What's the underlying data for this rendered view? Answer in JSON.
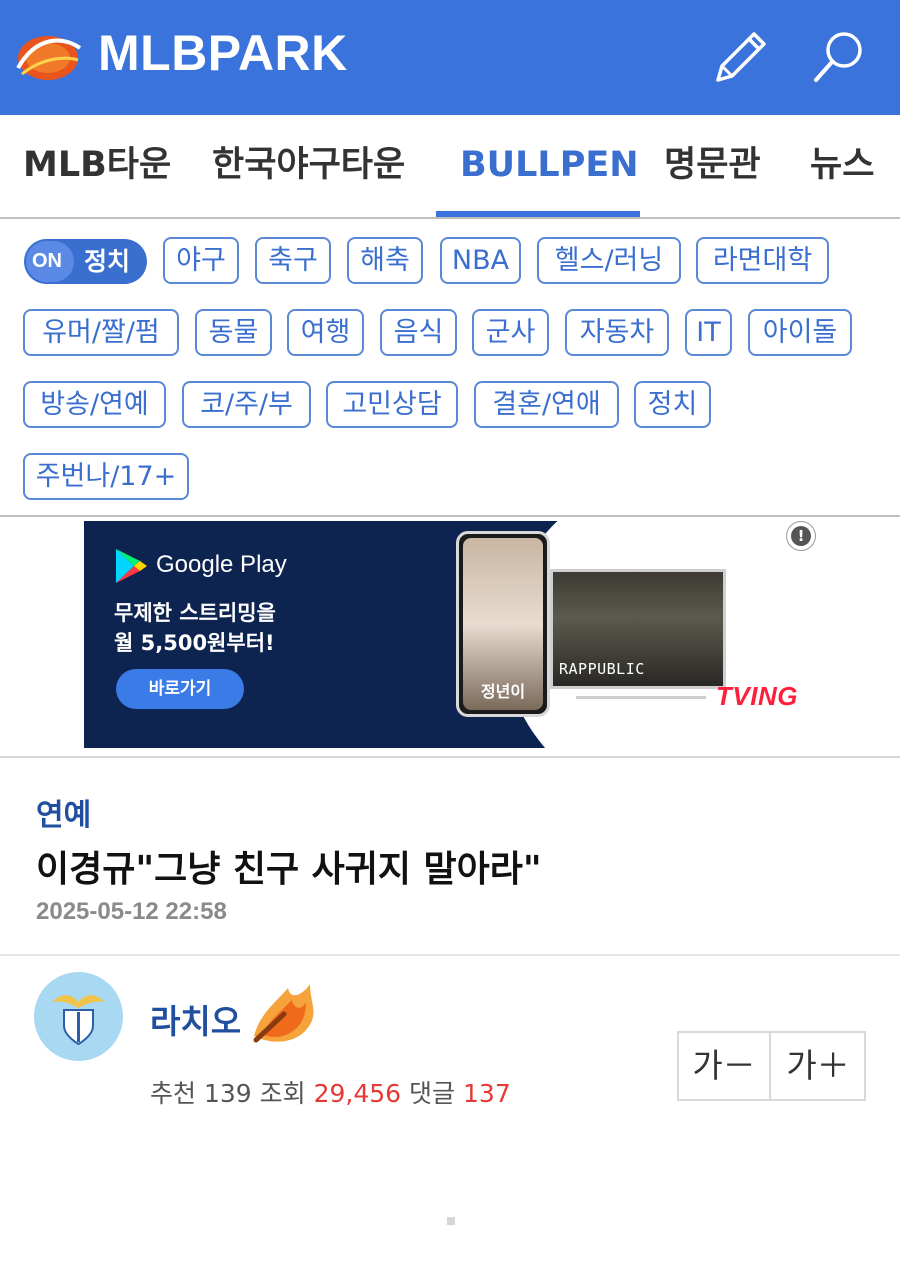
{
  "header": {
    "logo_text": "MLBPARK",
    "brand_color": "#3a73dc",
    "icons": [
      "pencil-icon",
      "search-icon"
    ]
  },
  "nav": {
    "tabs": [
      {
        "label": "MLB타운",
        "active": false
      },
      {
        "label": "한국야구타운",
        "active": false
      },
      {
        "label": "BULLPEN",
        "active": true
      },
      {
        "label": "명문관",
        "active": false
      },
      {
        "label": "뉴스",
        "active": false
      }
    ]
  },
  "tags": {
    "toggle": {
      "state": "ON",
      "label": "정치"
    },
    "items": [
      "야구",
      "축구",
      "해축",
      "NBA",
      "헬스/러닝",
      "라면대학",
      "유머/짤/펌",
      "동물",
      "여행",
      "음식",
      "군사",
      "자동차",
      "IT",
      "아이돌",
      "방송/연예",
      "코/주/부",
      "고민상담",
      "결혼/연애",
      "정치",
      "주번나/17+"
    ]
  },
  "ad": {
    "store": "Google Play",
    "line1": "무제한 스트리밍을",
    "line2": "월 5,500원부터!",
    "cta": "바로가기",
    "phone_caption": "정년이",
    "tv_title": "RAPPUBLIC",
    "brand": "TVING",
    "info": "!"
  },
  "article": {
    "category": "연예",
    "title": "이경규\"그냥 친구 사귀지 말아라\"",
    "date": "2025-05-12 22:58",
    "author": "라치오",
    "stats": {
      "recommend_label": "추천",
      "recommend": "139",
      "views_label": "조회",
      "views": "29,456",
      "comments_label": "댓글",
      "comments": "137"
    },
    "font_decrease": "가－",
    "font_increase": "가＋"
  }
}
